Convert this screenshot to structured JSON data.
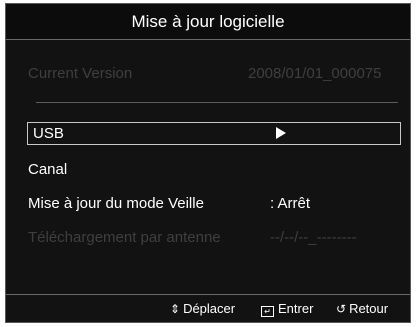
{
  "title": "Mise à jour logicielle",
  "current_version": {
    "label": "Current Version",
    "value": "2008/01/01_000075"
  },
  "items": [
    {
      "label": "USB",
      "value": "",
      "arrow": "right-arrow-icon"
    },
    {
      "label": "Canal",
      "value": ""
    },
    {
      "label": "Mise à jour du mode Veille",
      "value": ": Arrêt"
    },
    {
      "label": "Téléchargement par antenne",
      "value": "--/--/--_--------"
    }
  ],
  "footer": {
    "move_icon": "⇕",
    "move_label": "Déplacer",
    "enter_label": "Entrer",
    "return_icon": "↺",
    "return_label": "Retour"
  },
  "colors": {
    "background": "#121212",
    "text": "#ffffff",
    "disabled_text": "#3f3f3f",
    "border": "#5a5a5a"
  }
}
